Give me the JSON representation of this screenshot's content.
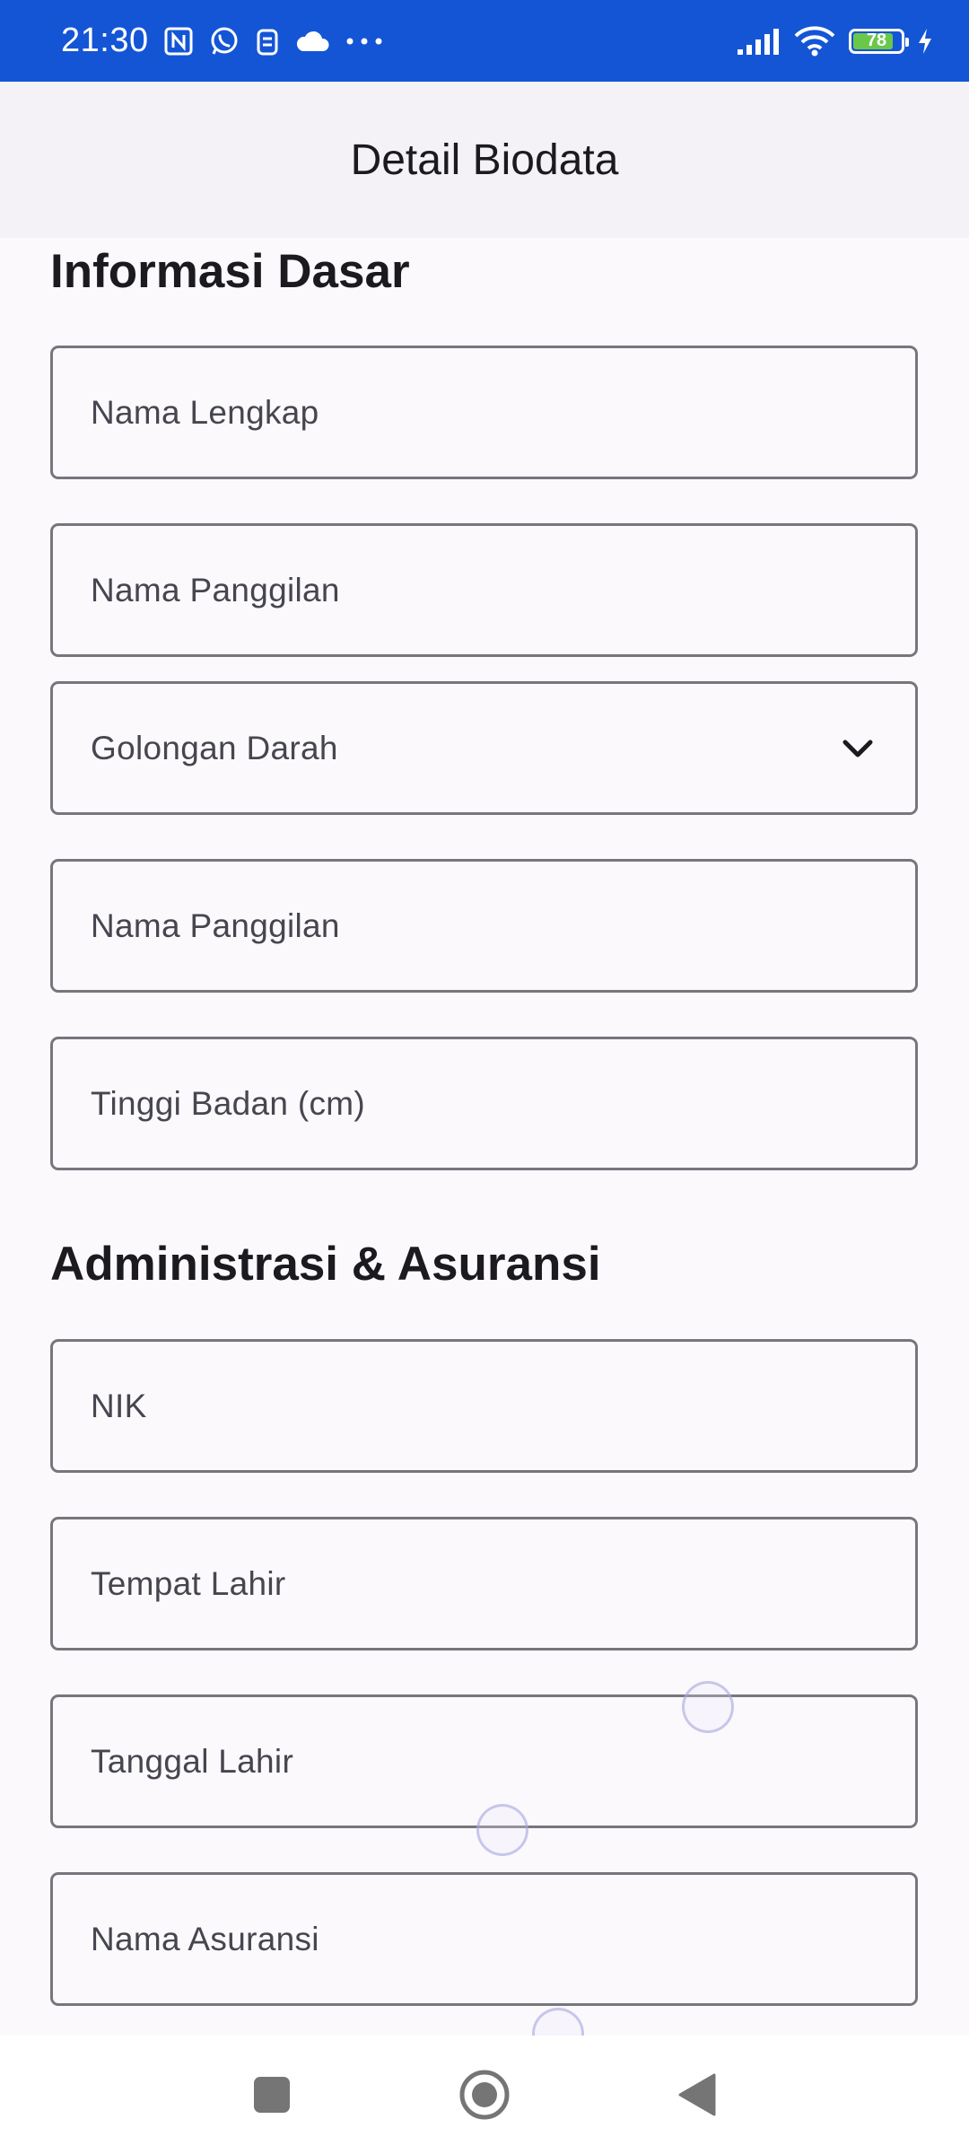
{
  "status_bar": {
    "time": "21:30",
    "battery_level": "78",
    "icons": [
      "nfc-icon",
      "whatsapp-icon",
      "clipboard-icon",
      "cloud-icon",
      "more-dots-icon",
      "signal-icon",
      "wifi-icon",
      "battery-icon",
      "charging-icon"
    ],
    "background_color": "#1455d6"
  },
  "app_bar": {
    "title": "Detail Biodata"
  },
  "sections": {
    "basic": {
      "title": "Informasi Dasar",
      "fields": {
        "full_name": "Nama Lengkap",
        "nickname": "Nama Panggilan",
        "blood_type": "Golongan Darah",
        "nickname_2": "Nama Panggilan",
        "height": "Tinggi Badan (cm)"
      }
    },
    "admin": {
      "title": "Administrasi & Asuransi",
      "fields": {
        "nik": "NIK",
        "birth_place": "Tempat Lahir",
        "birth_date": "Tanggal Lahir",
        "insurance_name": "Nama Asuransi"
      }
    }
  },
  "nav_bar": {
    "buttons": [
      "recents-button",
      "home-button",
      "back-button"
    ]
  }
}
